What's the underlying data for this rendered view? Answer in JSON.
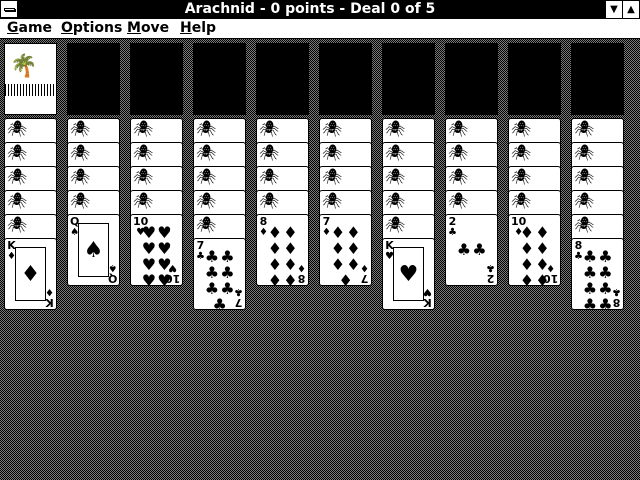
{
  "title": "Arachnid - 0 points - Deal 0 of 5",
  "menus": [
    {
      "label": "Game",
      "accel": "G",
      "rest": "ame"
    },
    {
      "label": "Options",
      "accel": "O",
      "rest": "ptions"
    },
    {
      "label": "Move",
      "accel": "M",
      "rest": "ove"
    },
    {
      "label": "Help",
      "accel": "H",
      "rest": "elp"
    }
  ],
  "icons": {
    "system_menu": "system-menu-icon",
    "minimize": "minimize-icon",
    "maximize": "maximize-icon",
    "card_back": "spider-card-back-icon",
    "stock": "palm-tree-stock-icon"
  },
  "columns": [
    {
      "hidden": 5,
      "face": [
        {
          "rank": "K",
          "suit": "♦"
        }
      ]
    },
    {
      "hidden": 4,
      "face": [
        {
          "rank": "Q",
          "suit": "♠"
        }
      ]
    },
    {
      "hidden": 4,
      "face": [
        {
          "rank": "10",
          "suit": "♥"
        }
      ]
    },
    {
      "hidden": 5,
      "face": [
        {
          "rank": "7",
          "suit": "♣"
        }
      ]
    },
    {
      "hidden": 4,
      "face": [
        {
          "rank": "8",
          "suit": "♦"
        }
      ]
    },
    {
      "hidden": 4,
      "face": [
        {
          "rank": "7",
          "suit": "♦"
        }
      ]
    },
    {
      "hidden": 5,
      "face": [
        {
          "rank": "K",
          "suit": "♥"
        }
      ]
    },
    {
      "hidden": 4,
      "face": [
        {
          "rank": "2",
          "suit": "♣"
        }
      ]
    },
    {
      "hidden": 4,
      "face": [
        {
          "rank": "10",
          "suit": "♦"
        }
      ]
    },
    {
      "hidden": 5,
      "face": [
        {
          "rank": "8",
          "suit": "♣"
        }
      ]
    }
  ]
}
